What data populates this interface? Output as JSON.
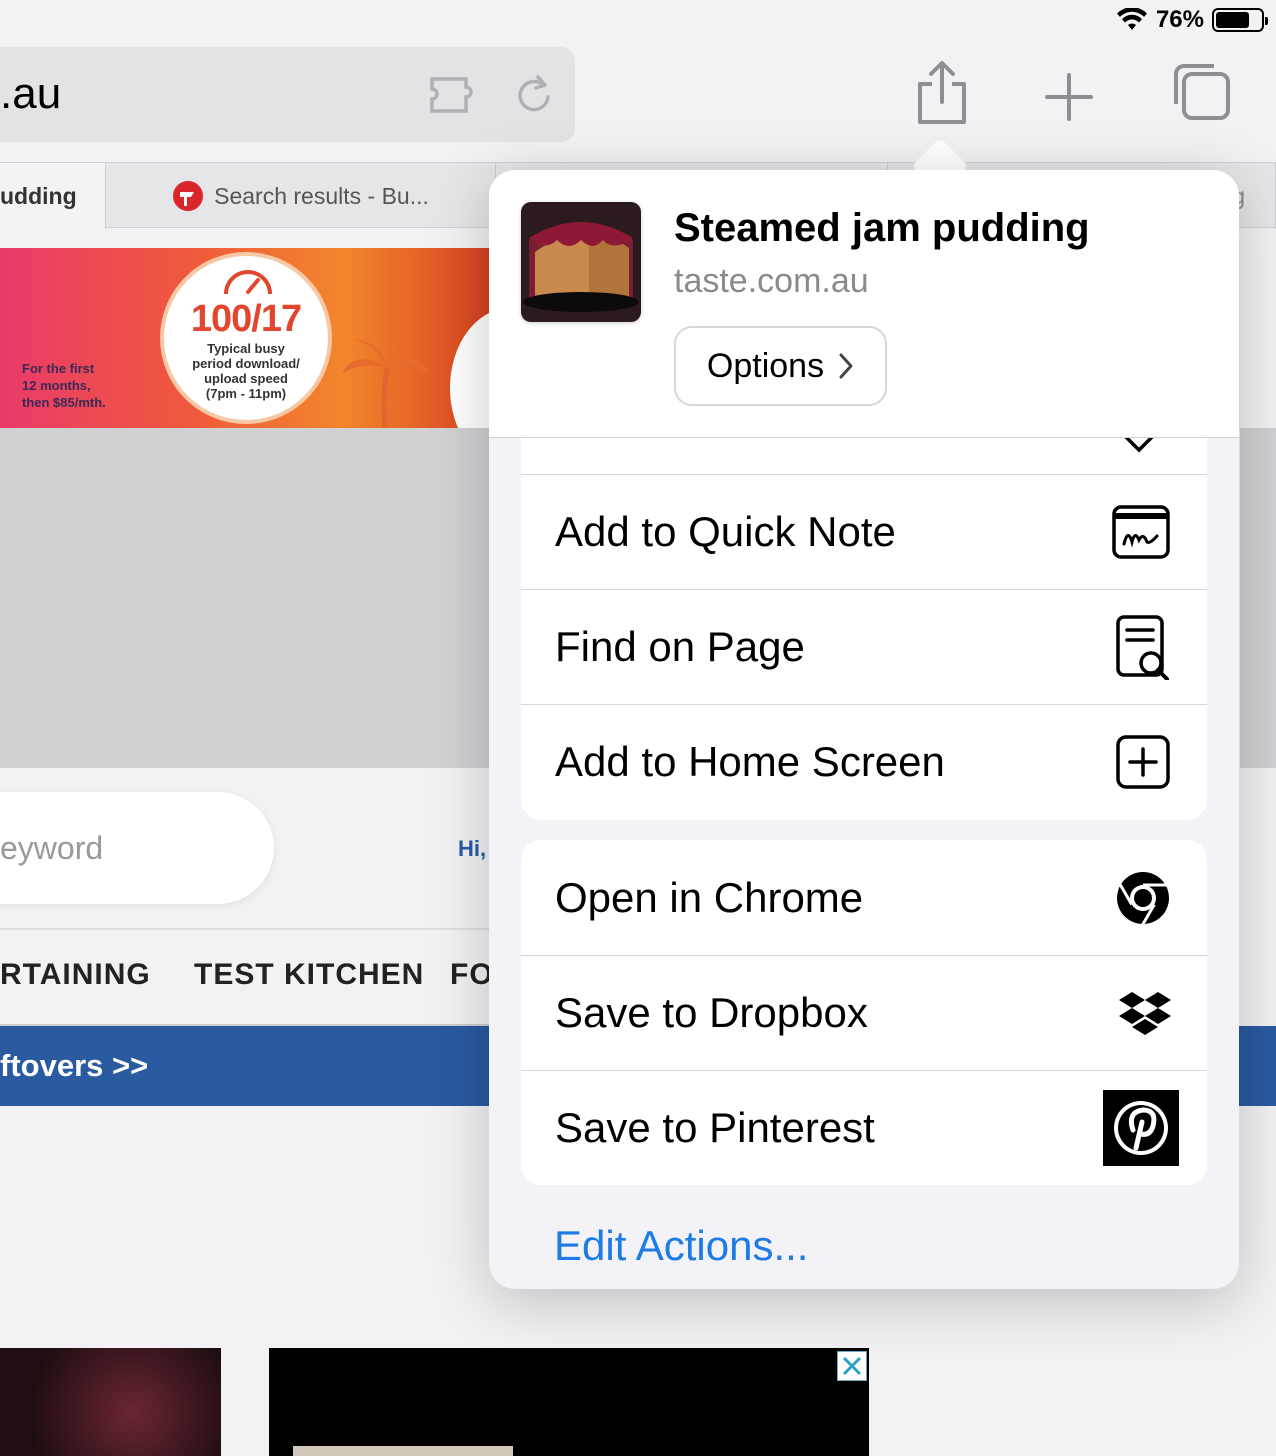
{
  "status": {
    "battery_text": "76%",
    "battery_level": 0.76
  },
  "toolbar": {
    "url_text": ".au"
  },
  "tabs": [
    {
      "label": "udding"
    },
    {
      "label": "Search results - Bu..."
    },
    {
      "label": ""
    },
    {
      "label": "g"
    }
  ],
  "page": {
    "ad": {
      "big_text": "100/17",
      "small_lines": [
        "Typical busy",
        "period download/",
        "upload speed",
        "(7pm - 11pm)"
      ],
      "left_lines": [
        "For the first",
        "12 months,",
        "then $85/mth."
      ]
    },
    "search_placeholder": "eyword",
    "hi_link": "Hi,",
    "nav_items": [
      "RTAINING",
      "TEST KITCHEN",
      "FO"
    ],
    "blue_banner_text": "ftovers >>"
  },
  "share_sheet": {
    "title": "Steamed jam pudding",
    "domain": "taste.com.au",
    "options_label": "Options",
    "group1": [
      {
        "label": "Add to Quick Note",
        "icon": "quick-note-icon"
      },
      {
        "label": "Find on Page",
        "icon": "find-on-page-icon"
      },
      {
        "label": "Add to Home Screen",
        "icon": "add-square-icon"
      }
    ],
    "group2": [
      {
        "label": "Open in Chrome",
        "icon": "chrome-icon"
      },
      {
        "label": "Save to Dropbox",
        "icon": "dropbox-icon"
      },
      {
        "label": "Save to Pinterest",
        "icon": "pinterest-icon"
      }
    ],
    "edit_actions_label": "Edit Actions..."
  },
  "colors": {
    "link_blue": "#1d7ae6",
    "nav_blue": "#2a5aa0"
  }
}
